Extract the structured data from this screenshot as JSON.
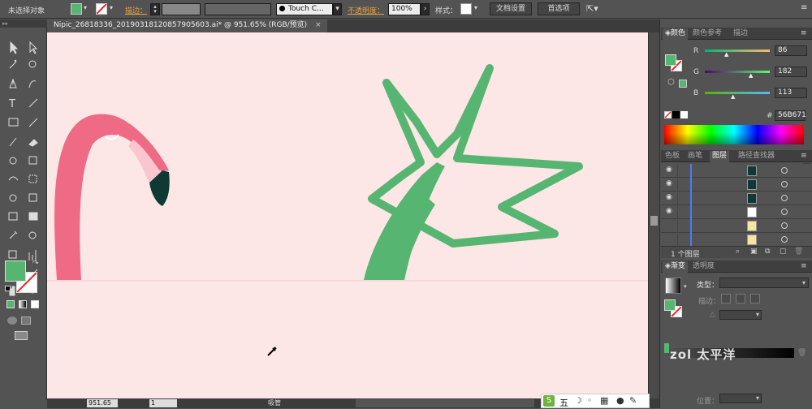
{
  "control_bar": {
    "selection_label": "未选择对象",
    "stroke_label": "描边：",
    "brush_label": "Touch C...",
    "opacity_label": "不透明度：",
    "opacity_value": "100%",
    "style_label": "样式：",
    "doc_setup": "文档设置",
    "preferences": "首选项"
  },
  "document_tab": {
    "title": "Nipic_26818336_20190318120857905603.ai* @ 951.65% (RGB/预览)",
    "close": "×"
  },
  "color_panel": {
    "tabs": [
      "颜色",
      "颜色参考",
      "描边"
    ],
    "r_label": "R",
    "r_value": "86",
    "g_label": "G",
    "g_value": "182",
    "b_label": "B",
    "b_value": "113",
    "hash": "#",
    "hex": "56B671"
  },
  "layers_panel": {
    "tabs": [
      "色板",
      "画笔",
      "图层",
      "路径查找器"
    ],
    "count_label": "1 个图层"
  },
  "gradient_panel": {
    "tabs": [
      "渐变",
      "透明度"
    ],
    "type_label": "类型：",
    "stroke_label": "描边：",
    "position_label": "位置："
  },
  "status_bar": {
    "zoom": "951.65",
    "page": "1",
    "status": "吸管"
  },
  "taskbar": {
    "ime": "五"
  },
  "watermark": "zol 太平洋",
  "colors": {
    "fill": "#56B671",
    "canvas": "#FDE6E6",
    "flamingo": "#EE6A85",
    "beak": "#0E3A33"
  }
}
